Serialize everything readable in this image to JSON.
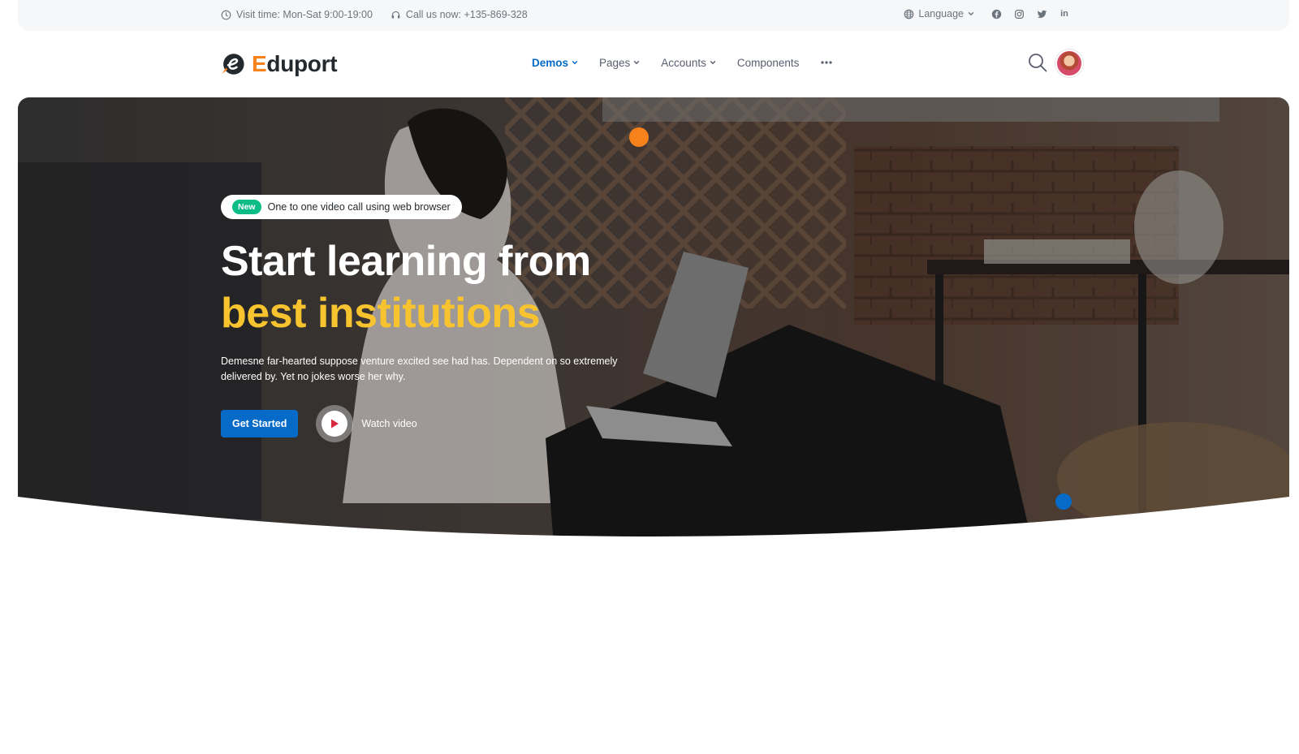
{
  "topbar": {
    "visit_time": "Visit time: Mon-Sat 9:00-19:00",
    "call_us": "Call us now: +135-869-328",
    "language": "Language",
    "social": [
      {
        "icon": "facebook-icon"
      },
      {
        "icon": "instagram-icon"
      },
      {
        "icon": "twitter-icon"
      },
      {
        "icon": "linkedin-icon",
        "text": "in"
      }
    ]
  },
  "header": {
    "logo_first": "E",
    "logo_rest": "duport",
    "nav": [
      {
        "label": "Demos",
        "active": true,
        "dropdown": true
      },
      {
        "label": "Pages",
        "active": false,
        "dropdown": true
      },
      {
        "label": "Accounts",
        "active": false,
        "dropdown": true
      },
      {
        "label": "Components",
        "active": false,
        "dropdown": false
      }
    ],
    "more_icon": "ellipsis-icon"
  },
  "hero": {
    "badge": "New",
    "badge_text": "One to one video call using web browser",
    "title_line1": "Start learning from",
    "title_line2": "best institutions",
    "description": "Demesne far-hearted suppose venture excited see had has. Dependent on so extremely delivered by. Yet no jokes worse her why.",
    "cta_primary": "Get Started",
    "cta_video": "Watch video"
  },
  "colors": {
    "primary": "#066ac9",
    "accent_orange": "#f7821b",
    "accent_yellow": "#f7c32e",
    "success": "#0cbc87"
  }
}
